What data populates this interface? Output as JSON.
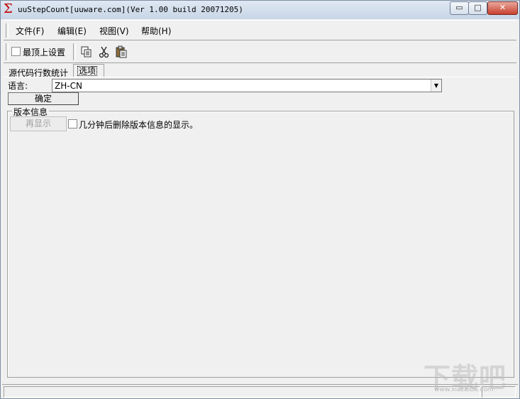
{
  "window": {
    "app_icon": "sigma-icon",
    "title": "uuStepCount[uuware.com](Ver 1.00 build 20071205)",
    "controls": {
      "minimize": "▭",
      "maximize": "□",
      "close": "✕"
    }
  },
  "menu": {
    "items": [
      {
        "label": "文件(F)"
      },
      {
        "label": "编辑(E)"
      },
      {
        "label": "视图(V)"
      },
      {
        "label": "帮助(H)"
      }
    ]
  },
  "toolbar": {
    "topmost_label": "最顶上设置",
    "topmost_checked": false,
    "icons": [
      "copy-icon",
      "cut-icon",
      "paste-icon"
    ]
  },
  "tabs": [
    {
      "label": "源代码行数统计",
      "active": false
    },
    {
      "label": "选项",
      "active": true
    }
  ],
  "options": {
    "language_label": "语言:",
    "language_value": "ZH-CN",
    "ok_label": "确定",
    "version_group_title": "版本信息",
    "redisplay_label": "再显示",
    "redisplay_enabled": false,
    "hide_version_label": "几分钟后删除版本信息的显示。",
    "hide_version_checked": false
  },
  "watermark": {
    "brand": "下载吧",
    "url": "www.xiazaiba.com"
  },
  "colors": {
    "window_bg": "#f0f0f0",
    "app_icon": "#c00000",
    "close_button": "#c8402e"
  }
}
